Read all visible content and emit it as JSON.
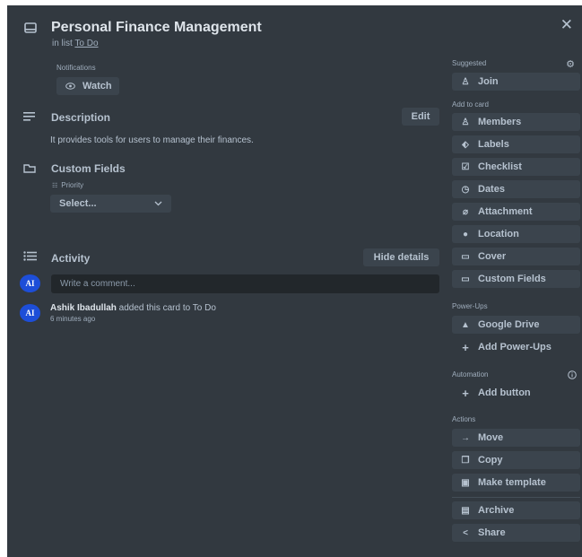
{
  "header": {
    "title": "Personal Finance Management",
    "in_list_prefix": "in list",
    "list_name": "To Do",
    "close_glyph": "✕",
    "card_icon": "card-icon"
  },
  "notifications": {
    "label": "Notifications",
    "watch_label": "Watch",
    "icon": "eye-icon"
  },
  "description": {
    "title": "Description",
    "edit_label": "Edit",
    "text": "It provides tools for users to manage their finances."
  },
  "custom_fields": {
    "title": "Custom Fields",
    "field_label": "Priority",
    "select_value": "Select..."
  },
  "activity": {
    "title": "Activity",
    "hide_details_label": "Hide details",
    "comment_placeholder": "Write a comment...",
    "avatar_initials": "AI",
    "entries": [
      {
        "user": "Ashik Ibadullah",
        "action": " added this card to To Do",
        "time": "6 minutes ago"
      }
    ]
  },
  "sidebar": {
    "suggested_label": "Suggested",
    "join_label": "Join",
    "add_to_card_label": "Add to card",
    "add_to_card": [
      "Members",
      "Labels",
      "Checklist",
      "Dates",
      "Attachment",
      "Location",
      "Cover",
      "Custom Fields"
    ],
    "power_ups_label": "Power-Ups",
    "power_ups": [
      "Google Drive",
      "Add Power-Ups"
    ],
    "automation_label": "Automation",
    "automation": [
      "Add button"
    ],
    "actions_label": "Actions",
    "actions": [
      "Move",
      "Copy",
      "Make template",
      "Archive",
      "Share"
    ]
  },
  "colors": {
    "modal_bg": "#323940",
    "button_bg": "#3b444d",
    "input_bg": "#22272b",
    "avatar_bg": "#1d4ed8",
    "text": "#b6c2cf"
  }
}
